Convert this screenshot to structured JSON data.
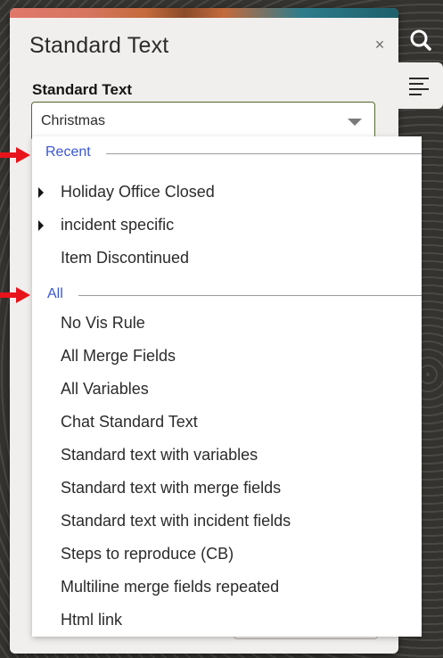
{
  "panel": {
    "title": "Standard Text",
    "close_symbol": "×",
    "field_label": "Standard Text",
    "selected_value": "Christmas"
  },
  "rail": {
    "search_icon": "search-icon",
    "menu_icon": "text-align-left-icon"
  },
  "dropdown": {
    "recent": {
      "label": "Recent",
      "items": [
        {
          "label": "Holiday Office Closed",
          "expandable": true
        },
        {
          "label": "incident specific",
          "expandable": true
        },
        {
          "label": "Item Discontinued",
          "expandable": false
        }
      ]
    },
    "all": {
      "label": "All",
      "items": [
        {
          "label": "No Vis Rule"
        },
        {
          "label": "All Merge Fields"
        },
        {
          "label": "All Variables"
        },
        {
          "label": "Chat Standard Text"
        },
        {
          "label": "Standard text with variables"
        },
        {
          "label": "Standard text with merge fields"
        },
        {
          "label": "Standard text with incident fields"
        },
        {
          "label": "Steps to reproduce (CB)"
        },
        {
          "label": "Multiline merge fields repeated"
        },
        {
          "label": "Html link"
        }
      ]
    }
  },
  "colors": {
    "annotation_arrow": "#e8141b",
    "group_label": "#3a56d6",
    "field_border": "#4f6b2d"
  }
}
